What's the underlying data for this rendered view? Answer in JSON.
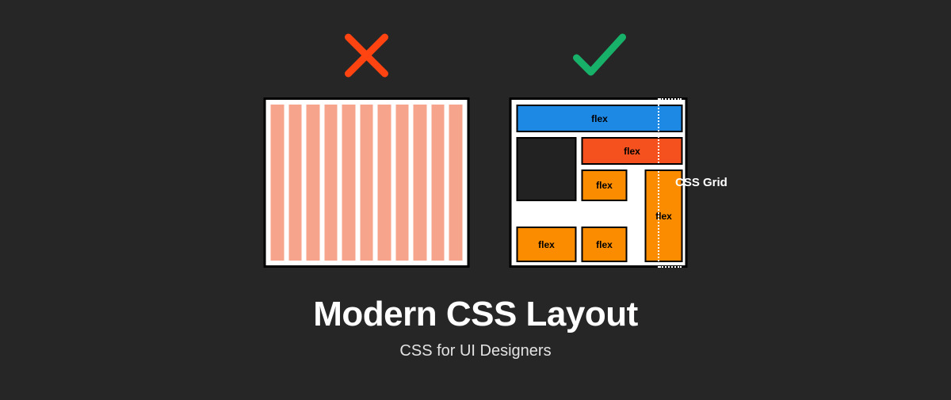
{
  "title": "Modern CSS Layout",
  "subtitle": "CSS for UI Designers",
  "grid_label": "CSS Grid",
  "colors": {
    "bg": "#272626",
    "cross": "#ff4411",
    "check": "#17b169",
    "blue": "#1e88e5",
    "orange": "#f4511e",
    "amber": "#fb8c00",
    "salmon": "#f6a48b"
  },
  "old_panel": {
    "columns": 11
  },
  "new_panel": {
    "cells": [
      {
        "color": "blue",
        "label": "flex"
      },
      {
        "color": "dark",
        "label": ""
      },
      {
        "color": "orange",
        "label": "flex"
      },
      {
        "color": "amber",
        "label": "flex"
      },
      {
        "color": "amber",
        "label": "flex"
      },
      {
        "color": "amber",
        "label": "flex"
      },
      {
        "color": "amber",
        "label": "flex"
      }
    ]
  }
}
